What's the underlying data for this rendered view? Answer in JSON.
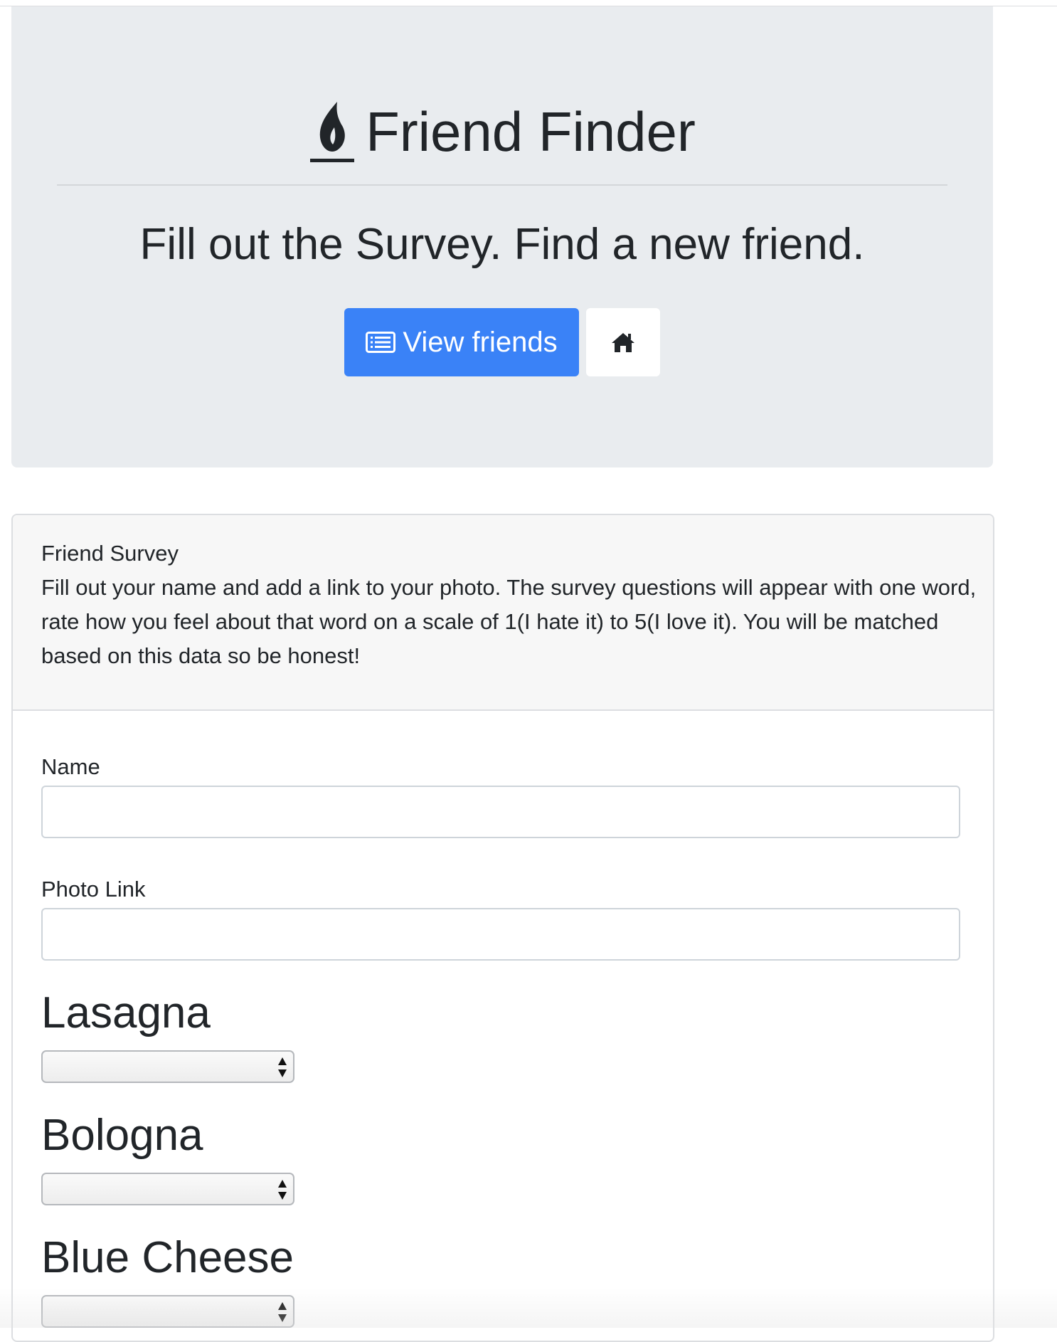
{
  "jumbotron": {
    "brand_icon": "fire-icon",
    "title": "Friend Finder",
    "lead": "Fill out the Survey. Find a new friend.",
    "view_friends_label": "View friends",
    "view_friends_icon": "list-alt-icon",
    "home_icon": "home-icon"
  },
  "survey": {
    "title": "Friend Survey",
    "instructions": "Fill out your name and add a link to your photo. The survey questions will appear with one word, rate how you feel about that word on a scale of 1(I hate it) to 5(I love it). You will be matched based on this data so be honest!",
    "name_label": "Name",
    "name_value": "",
    "photo_label": "Photo Link",
    "photo_value": "",
    "questions": [
      {
        "word": "Lasagna",
        "selected": ""
      },
      {
        "word": "Bologna",
        "selected": ""
      },
      {
        "word": "Blue Cheese",
        "selected": ""
      }
    ]
  },
  "colors": {
    "primary": "#3a82f7",
    "jumbotron_bg": "#e9ecef",
    "card_header_bg": "#f7f7f7",
    "text": "#212529"
  }
}
